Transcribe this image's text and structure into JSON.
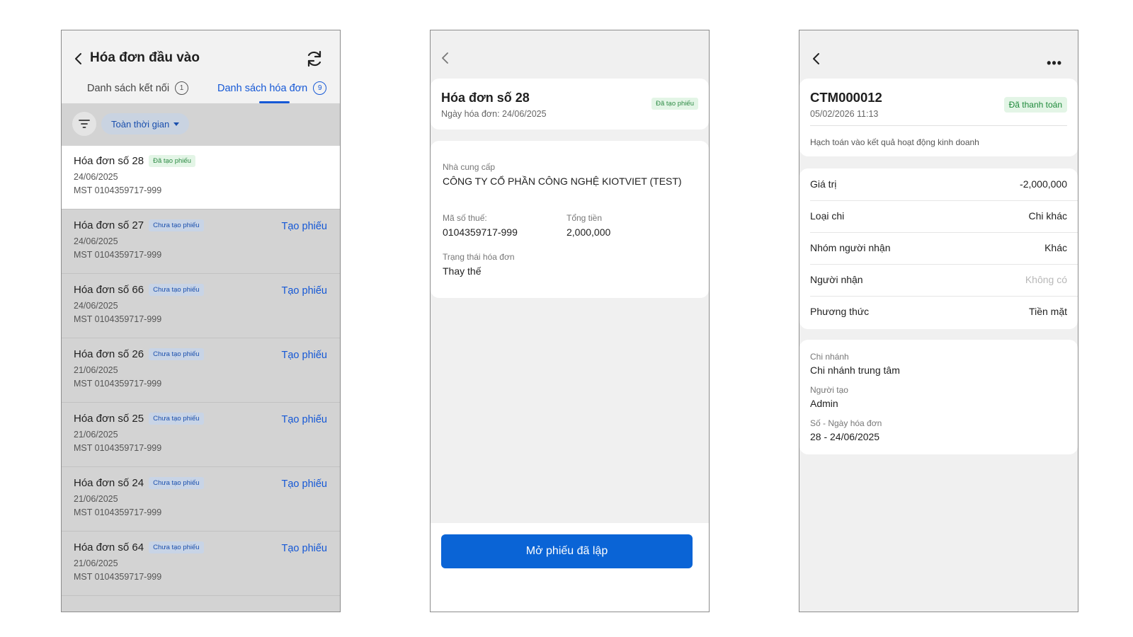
{
  "screen1": {
    "title": "Hóa đơn đầu vào",
    "tabs": [
      {
        "label": "Danh sách kết nối",
        "count": "1"
      },
      {
        "label": "Danh sách hóa đơn",
        "count": "9"
      }
    ],
    "filter_chip": "Toàn thời gian",
    "invoices": [
      {
        "title": "Hóa đơn số 28",
        "badge": "Đã tạo phiếu",
        "date": "24/06/2025",
        "mst": "MST 0104359717-999",
        "action": ""
      },
      {
        "title": "Hóa đơn số 27",
        "badge": "Chưa tạo phiếu",
        "date": "24/06/2025",
        "mst": "MST 0104359717-999",
        "action": "Tạo phiếu"
      },
      {
        "title": "Hóa đơn số 66",
        "badge": "Chưa tạo phiếu",
        "date": "24/06/2025",
        "mst": "MST 0104359717-999",
        "action": "Tạo phiếu"
      },
      {
        "title": "Hóa đơn số 26",
        "badge": "Chưa tạo phiếu",
        "date": "21/06/2025",
        "mst": "MST 0104359717-999",
        "action": "Tạo phiếu"
      },
      {
        "title": "Hóa đơn số 25",
        "badge": "Chưa tạo phiếu",
        "date": "21/06/2025",
        "mst": "MST 0104359717-999",
        "action": "Tạo phiếu"
      },
      {
        "title": "Hóa đơn số 24",
        "badge": "Chưa tạo phiếu",
        "date": "21/06/2025",
        "mst": "MST 0104359717-999",
        "action": "Tạo phiếu"
      },
      {
        "title": "Hóa đơn số 64",
        "badge": "Chưa tạo phiếu",
        "date": "21/06/2025",
        "mst": "MST 0104359717-999",
        "action": "Tạo phiếu"
      }
    ]
  },
  "screen2": {
    "title": "Hóa đơn số 28",
    "date": "Ngày hóa đơn: 24/06/2025",
    "badge": "Đã tạo phiếu",
    "supplier_label": "Nhà cung cấp",
    "supplier_value": "CÔNG TY CỔ PHẦN CÔNG NGHỆ KIOTVIET (TEST)",
    "tax_label": "Mã số thuế:",
    "tax_value": "0104359717-999",
    "total_label": "Tổng tiền",
    "total_value": "2,000,000",
    "status_label": "Trạng thái hóa đơn",
    "status_value": "Thay thế",
    "button": "Mở phiếu đã lập"
  },
  "screen3": {
    "code": "CTM000012",
    "datetime": "05/02/2026 11:13",
    "badge": "Đã thanh toán",
    "note": "Hạch toán vào kết quả hoạt động kinh doanh",
    "rows": [
      {
        "label": "Giá trị",
        "value": "-2,000,000"
      },
      {
        "label": "Loại chi",
        "value": "Chi khác"
      },
      {
        "label": "Nhóm người nhận",
        "value": "Khác"
      },
      {
        "label": "Người nhận",
        "value": "Không có"
      },
      {
        "label": "Phương thức",
        "value": "Tiền mặt"
      }
    ],
    "branch_label": "Chi nhánh",
    "branch_value": "Chi nhánh trung tâm",
    "creator_label": "Người tạo",
    "creator_value": "Admin",
    "invoice_label": "Số - Ngày hóa đơn",
    "invoice_value": "28 - 24/06/2025",
    "more_icon": "more-horizontal-icon"
  },
  "colors": {
    "primary": "#1558d6",
    "button": "#0a64d6",
    "success_bg": "#e3f5e6",
    "success_text": "#2e8b45",
    "overlay": "#d3d3d3"
  }
}
